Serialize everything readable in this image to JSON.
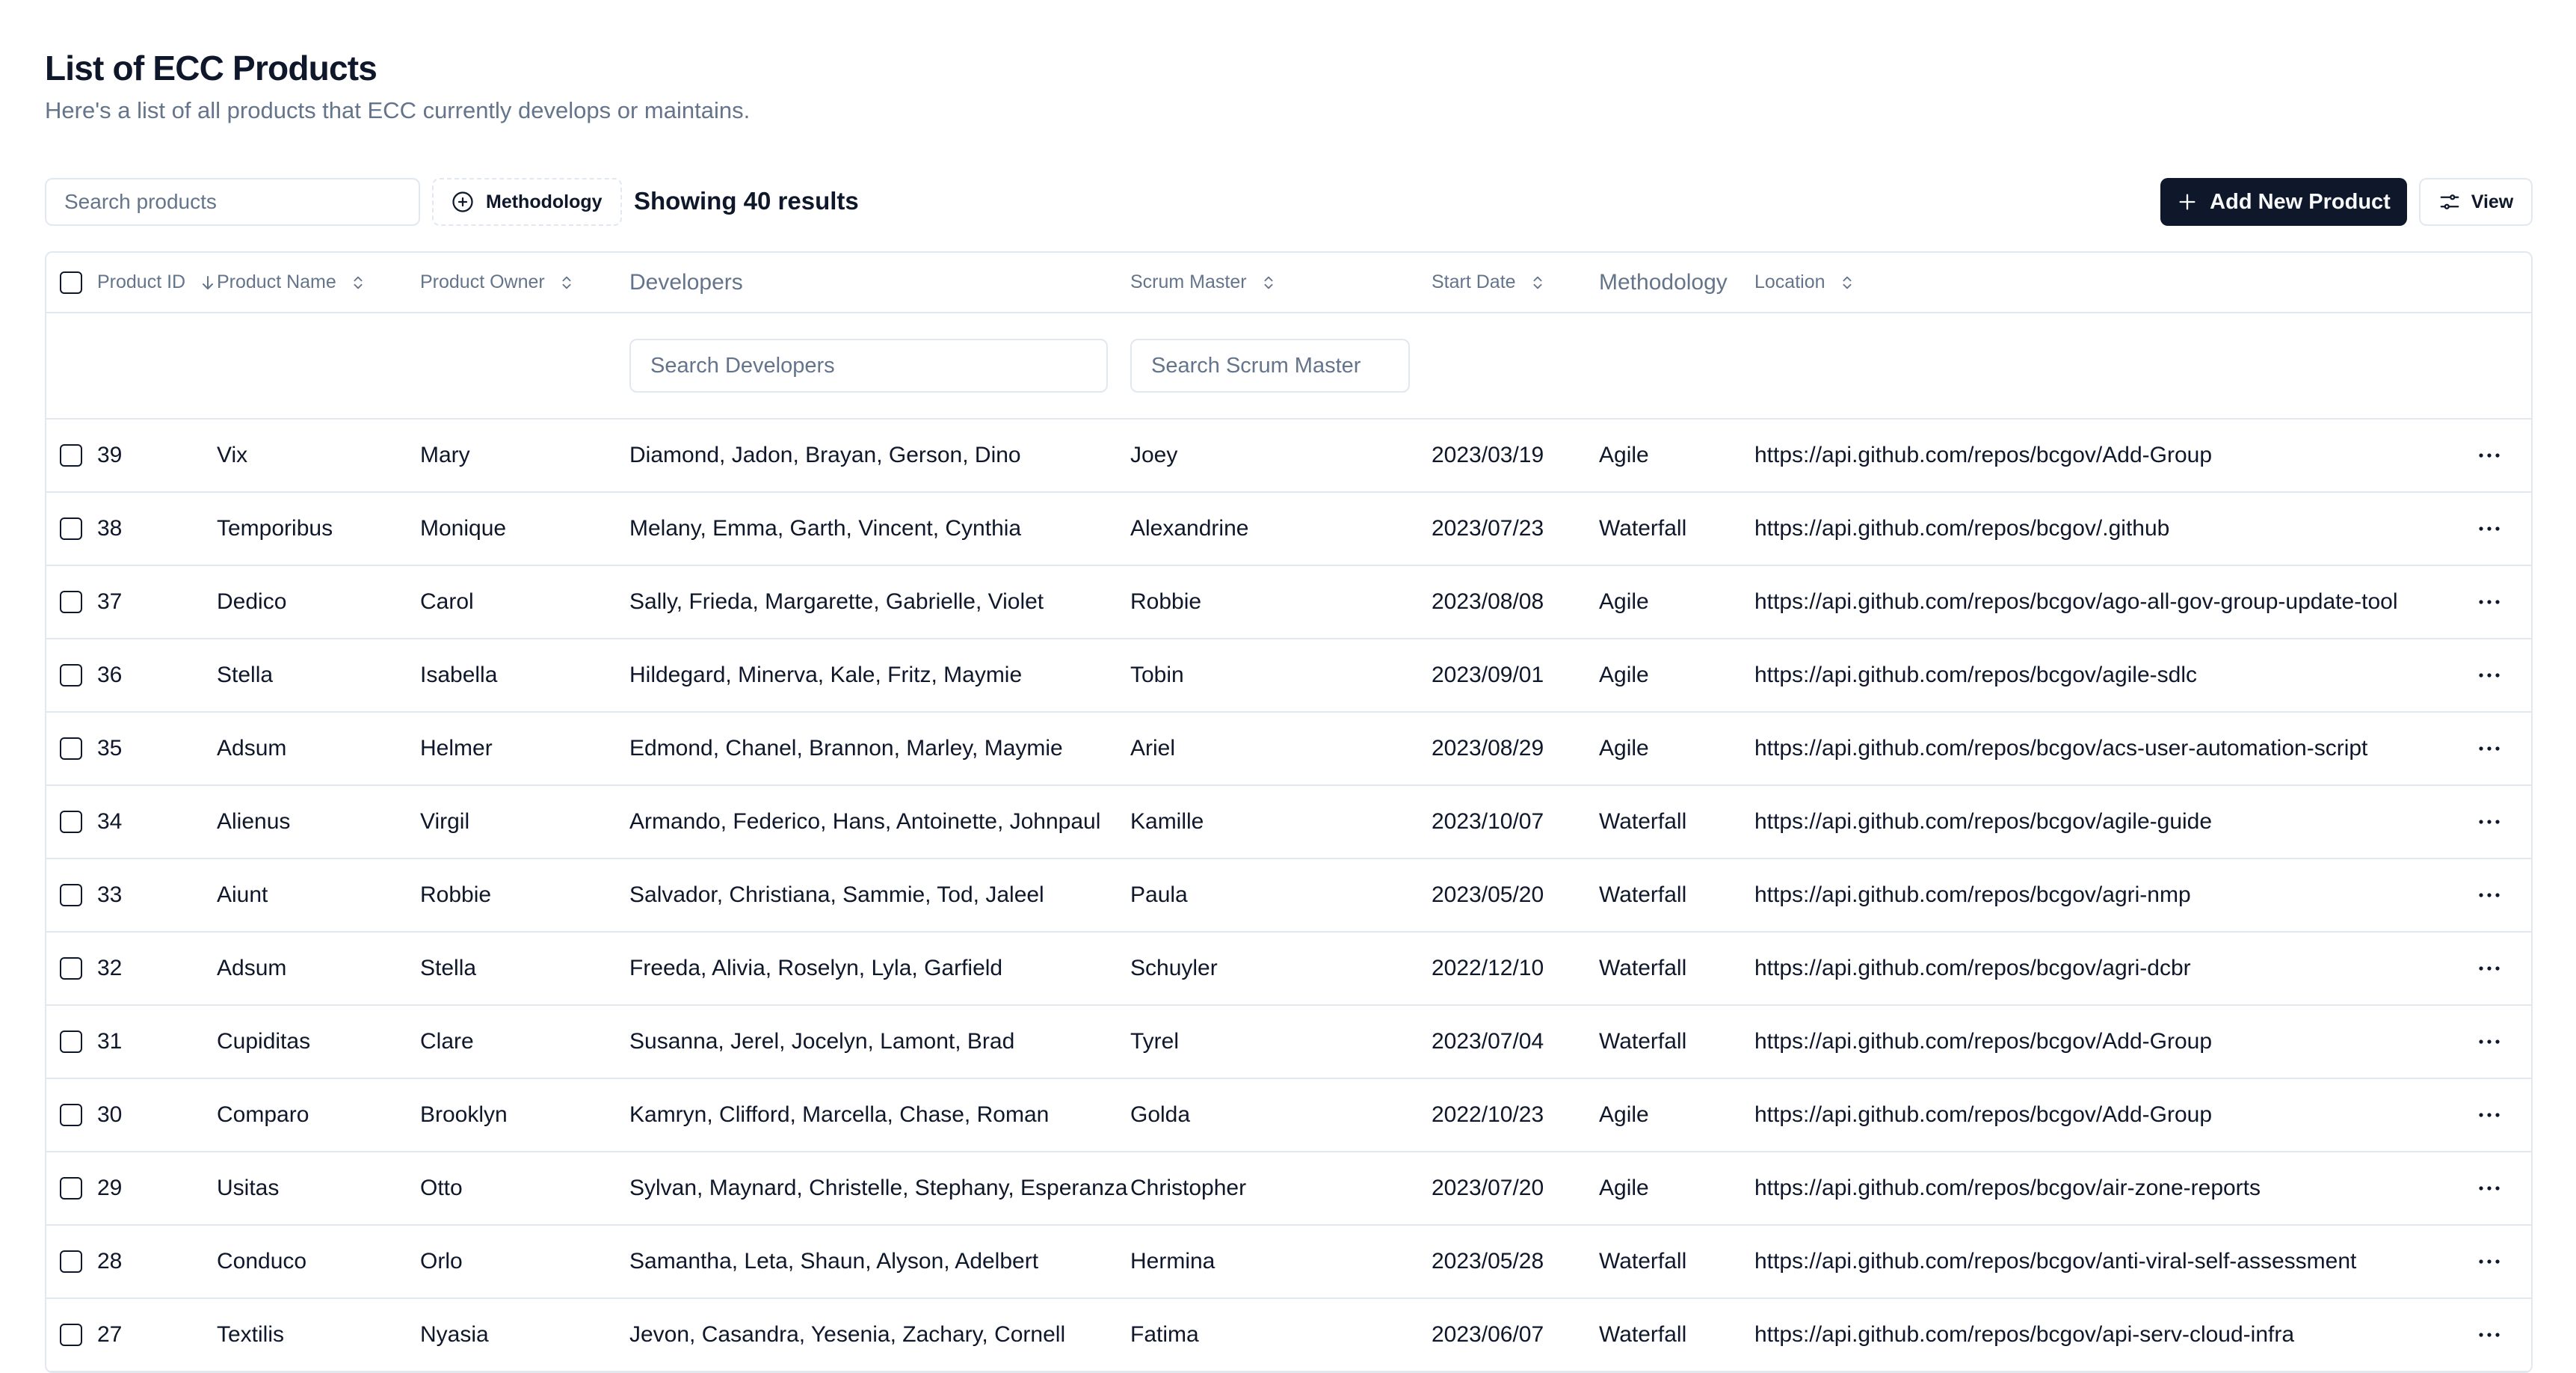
{
  "header": {
    "title": "List of ECC Products",
    "subtitle": "Here's a list of all products that ECC currently develops or maintains."
  },
  "toolbar": {
    "search_placeholder": "Search products",
    "methodology_filter_label": "Methodology",
    "results_text": "Showing 40 results",
    "add_button_label": "Add New Product",
    "view_button_label": "View"
  },
  "table": {
    "columns": {
      "product_id": "Product ID",
      "product_name": "Product Name",
      "product_owner": "Product Owner",
      "developers": "Developers",
      "scrum_master": "Scrum Master",
      "start_date": "Start Date",
      "methodology": "Methodology",
      "location": "Location"
    },
    "filters": {
      "developers_placeholder": "Search Developers",
      "scrum_master_placeholder": "Search Scrum Master"
    },
    "rows": [
      {
        "id": "39",
        "name": "Vix",
        "owner": "Mary",
        "developers": "Diamond, Jadon, Brayan, Gerson, Dino",
        "scrum_master": "Joey",
        "start_date": "2023/03/19",
        "methodology": "Agile",
        "location": "https://api.github.com/repos/bcgov/Add-Group"
      },
      {
        "id": "38",
        "name": "Temporibus",
        "owner": "Monique",
        "developers": "Melany, Emma, Garth, Vincent, Cynthia",
        "scrum_master": "Alexandrine",
        "start_date": "2023/07/23",
        "methodology": "Waterfall",
        "location": "https://api.github.com/repos/bcgov/.github"
      },
      {
        "id": "37",
        "name": "Dedico",
        "owner": "Carol",
        "developers": "Sally, Frieda, Margarette, Gabrielle, Violet",
        "scrum_master": "Robbie",
        "start_date": "2023/08/08",
        "methodology": "Agile",
        "location": "https://api.github.com/repos/bcgov/ago-all-gov-group-update-tool"
      },
      {
        "id": "36",
        "name": "Stella",
        "owner": "Isabella",
        "developers": "Hildegard, Minerva, Kale, Fritz, Maymie",
        "scrum_master": "Tobin",
        "start_date": "2023/09/01",
        "methodology": "Agile",
        "location": "https://api.github.com/repos/bcgov/agile-sdlc"
      },
      {
        "id": "35",
        "name": "Adsum",
        "owner": "Helmer",
        "developers": "Edmond, Chanel, Brannon, Marley, Maymie",
        "scrum_master": "Ariel",
        "start_date": "2023/08/29",
        "methodology": "Agile",
        "location": "https://api.github.com/repos/bcgov/acs-user-automation-script"
      },
      {
        "id": "34",
        "name": "Alienus",
        "owner": "Virgil",
        "developers": "Armando, Federico, Hans, Antoinette, Johnpaul",
        "scrum_master": "Kamille",
        "start_date": "2023/10/07",
        "methodology": "Waterfall",
        "location": "https://api.github.com/repos/bcgov/agile-guide"
      },
      {
        "id": "33",
        "name": "Aiunt",
        "owner": "Robbie",
        "developers": "Salvador, Christiana, Sammie, Tod, Jaleel",
        "scrum_master": "Paula",
        "start_date": "2023/05/20",
        "methodology": "Waterfall",
        "location": "https://api.github.com/repos/bcgov/agri-nmp"
      },
      {
        "id": "32",
        "name": "Adsum",
        "owner": "Stella",
        "developers": "Freeda, Alivia, Roselyn, Lyla, Garfield",
        "scrum_master": "Schuyler",
        "start_date": "2022/12/10",
        "methodology": "Waterfall",
        "location": "https://api.github.com/repos/bcgov/agri-dcbr"
      },
      {
        "id": "31",
        "name": "Cupiditas",
        "owner": "Clare",
        "developers": "Susanna, Jerel, Jocelyn, Lamont, Brad",
        "scrum_master": "Tyrel",
        "start_date": "2023/07/04",
        "methodology": "Waterfall",
        "location": "https://api.github.com/repos/bcgov/Add-Group"
      },
      {
        "id": "30",
        "name": "Comparo",
        "owner": "Brooklyn",
        "developers": "Kamryn, Clifford, Marcella, Chase, Roman",
        "scrum_master": "Golda",
        "start_date": "2022/10/23",
        "methodology": "Agile",
        "location": "https://api.github.com/repos/bcgov/Add-Group"
      },
      {
        "id": "29",
        "name": "Usitas",
        "owner": "Otto",
        "developers": "Sylvan, Maynard, Christelle, Stephany, Esperanza",
        "scrum_master": "Christopher",
        "start_date": "2023/07/20",
        "methodology": "Agile",
        "location": "https://api.github.com/repos/bcgov/air-zone-reports"
      },
      {
        "id": "28",
        "name": "Conduco",
        "owner": "Orlo",
        "developers": "Samantha, Leta, Shaun, Alyson, Adelbert",
        "scrum_master": "Hermina",
        "start_date": "2023/05/28",
        "methodology": "Waterfall",
        "location": "https://api.github.com/repos/bcgov/anti-viral-self-assessment"
      },
      {
        "id": "27",
        "name": "Textilis",
        "owner": "Nyasia",
        "developers": "Jevon, Casandra, Yesenia, Zachary, Cornell",
        "scrum_master": "Fatima",
        "start_date": "2023/06/07",
        "methodology": "Waterfall",
        "location": "https://api.github.com/repos/bcgov/api-serv-cloud-infra"
      }
    ]
  }
}
